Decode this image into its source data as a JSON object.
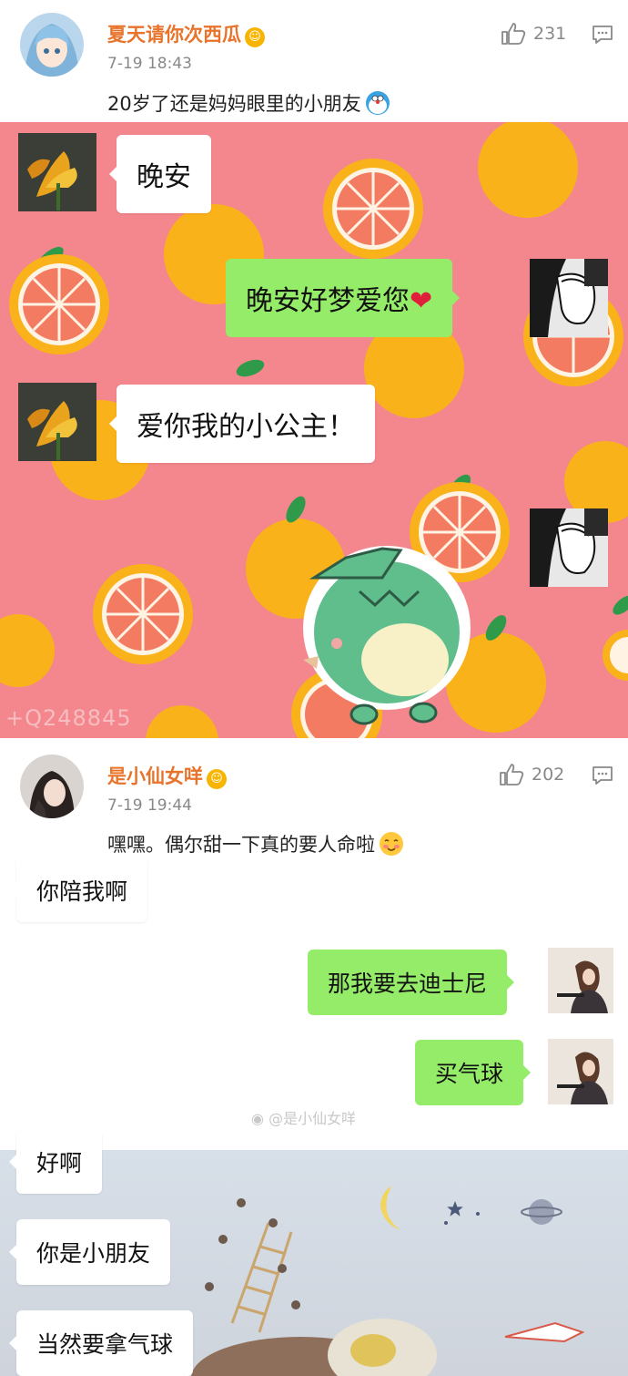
{
  "comment1": {
    "username": "夏天请你次西瓜",
    "time": "7-19 18:43",
    "text": "20岁了还是妈妈眼里的小朋友",
    "likes": "231"
  },
  "chat1": {
    "msg1": "晚安",
    "msg2": "晚安好梦爱您",
    "msg3": "爱你我的小公主！",
    "watermark": "+Q248845"
  },
  "comment2": {
    "username": "是小仙女咩",
    "time": "7-19 19:44",
    "text": "嘿嘿。偶尔甜一下真的要人命啦",
    "likes": "202"
  },
  "chat2": {
    "msg1": "你陪我啊",
    "msg2": "那我要去迪士尼",
    "msg3": "买气球",
    "msg4": "好啊",
    "msg5": "你是小朋友",
    "msg6": "当然要拿气球",
    "watermark": "@是小仙女咩"
  },
  "colors": {
    "accent_name": "#e8732a",
    "chat_green": "#95ec69",
    "pink_bg": "#f3878d",
    "orange": "#f9b21a"
  }
}
